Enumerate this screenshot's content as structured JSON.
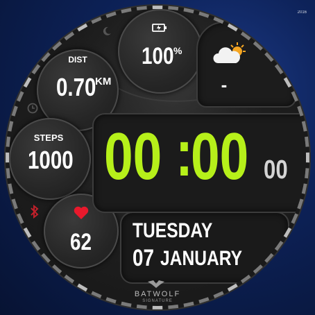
{
  "corner_mark": "2016",
  "battery": {
    "icon": "battery-charging-icon",
    "value": "100",
    "unit": "%"
  },
  "weather": {
    "icon": "partly-cloudy-icon",
    "value": "-"
  },
  "distance": {
    "label": "DIST",
    "value": "0.70",
    "unit": "KM"
  },
  "steps": {
    "label": "STEPS",
    "value": "1000"
  },
  "heart": {
    "icon": "heart-icon",
    "value": "62"
  },
  "time": {
    "hours": "00",
    "separator": ":",
    "minutes": "00",
    "seconds": "00"
  },
  "date": {
    "weekday": "TUESDAY",
    "day": "07",
    "month": "JANUARY"
  },
  "brand": {
    "name": "BATWOLF",
    "line2": "SIGNATURE"
  },
  "colors": {
    "time_accent": "#b6f01a",
    "heart": "#e8192c",
    "bluetooth": "#c0202a",
    "weather_sun": "#f5a623",
    "background": "#0d2259"
  },
  "status_icons": [
    "moon-icon",
    "alarm-clock-icon",
    "bluetooth-icon"
  ]
}
